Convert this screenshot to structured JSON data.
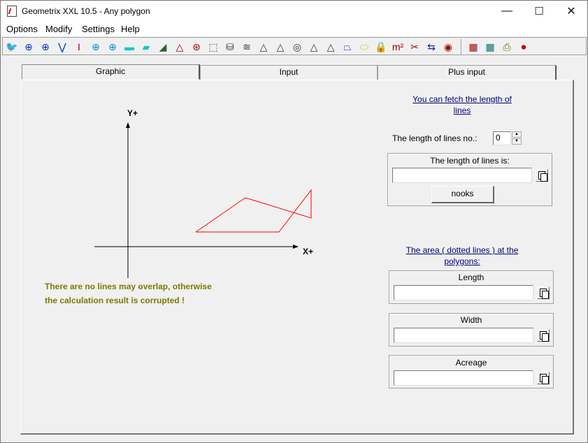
{
  "window": {
    "title": "Geometrix XXL 10.5 - Any polygon",
    "minimize_glyph": "—",
    "maximize_glyph": "☐",
    "close_glyph": "✕"
  },
  "menu": {
    "items": [
      "Options",
      "Modify",
      "Settings",
      "Help"
    ]
  },
  "toolbar": {
    "icons": [
      {
        "name": "bird-icon",
        "glyph": "🐦",
        "color": "#1a3f9c"
      },
      {
        "name": "circle-cross-icon",
        "glyph": "⊕",
        "color": "#0030c0"
      },
      {
        "name": "circle-cross-filled-icon",
        "glyph": "⊕",
        "color": "#0030c0"
      },
      {
        "name": "graph-icon",
        "glyph": "⋁",
        "color": "#0030c0"
      },
      {
        "name": "i-beam-icon",
        "glyph": "I",
        "color": "#a00000"
      },
      {
        "name": "disc-cross-icon",
        "glyph": "⊕",
        "color": "#0090d0"
      },
      {
        "name": "disc-cross-2-icon",
        "glyph": "⊕",
        "color": "#0090d0"
      },
      {
        "name": "rectangle-icon",
        "glyph": "▬",
        "color": "#00c8d0"
      },
      {
        "name": "parallelogram-icon",
        "glyph": "▰",
        "color": "#00c8d0"
      },
      {
        "name": "right-triangle-icon",
        "glyph": "◢",
        "color": "#226622"
      },
      {
        "name": "triangle-icon",
        "glyph": "△",
        "color": "#a00000"
      },
      {
        "name": "circle-triangle-icon",
        "glyph": "⊛",
        "color": "#a00000"
      },
      {
        "name": "cube-icon",
        "glyph": "⬚",
        "color": "#333"
      },
      {
        "name": "cylinder-icon",
        "glyph": "⛁",
        "color": "#333"
      },
      {
        "name": "stacked-cylinder-icon",
        "glyph": "≋",
        "color": "#333"
      },
      {
        "name": "pyramid-icon",
        "glyph": "△",
        "color": "#333"
      },
      {
        "name": "pyramid-2-icon",
        "glyph": "△",
        "color": "#333"
      },
      {
        "name": "sphere-icon",
        "glyph": "◎",
        "color": "#333"
      },
      {
        "name": "cone-icon",
        "glyph": "△",
        "color": "#333"
      },
      {
        "name": "cone-2-icon",
        "glyph": "△",
        "color": "#333"
      },
      {
        "name": "trapezoid-icon",
        "glyph": "⏢",
        "color": "#1020b0"
      },
      {
        "name": "ellipse-icon",
        "glyph": "⬭",
        "color": "#c8c800"
      },
      {
        "name": "lock-icon",
        "glyph": "🔒",
        "color": "#444"
      },
      {
        "name": "measure-icon",
        "glyph": "m²",
        "color": "#a00000"
      },
      {
        "name": "scissors-icon",
        "glyph": "✂",
        "color": "#a00000"
      },
      {
        "name": "arrows-icon",
        "glyph": "⇆",
        "color": "#1020b0"
      },
      {
        "name": "eye-icon",
        "glyph": "◉",
        "color": "#a00000"
      },
      {
        "name": "sheet-icon",
        "glyph": "▦",
        "color": "#a00000"
      },
      {
        "name": "calculator-icon",
        "glyph": "▦",
        "color": "#007070"
      },
      {
        "name": "printer-icon",
        "glyph": "⎙",
        "color": "#806000"
      },
      {
        "name": "stop-icon",
        "glyph": "⏺",
        "color": "#d00000"
      }
    ]
  },
  "tabs": [
    "Graphic",
    "Input",
    "Plus input"
  ],
  "graphic": {
    "y_label": "Y+",
    "x_label": "X+",
    "warning_line1": "There are no lines may overlap, otherwise",
    "warning_line2": "the calculation result is corrupted !",
    "polygon_color": "#ff0000",
    "warning_color": "#7a7a00"
  },
  "lines": {
    "link_text": "You can fetch the length of\nlines",
    "no_label": "The length of lines no.:",
    "no_value": "0",
    "result_label": "The length of lines is:",
    "result_value": "",
    "nooks_button": "nooks"
  },
  "area": {
    "link_text": "The area ( dotted lines ) at the\npolygons:",
    "length_label": "Length",
    "length_value": "",
    "width_label": "Width",
    "width_value": "",
    "acreage_label": "Acreage",
    "acreage_value": ""
  }
}
